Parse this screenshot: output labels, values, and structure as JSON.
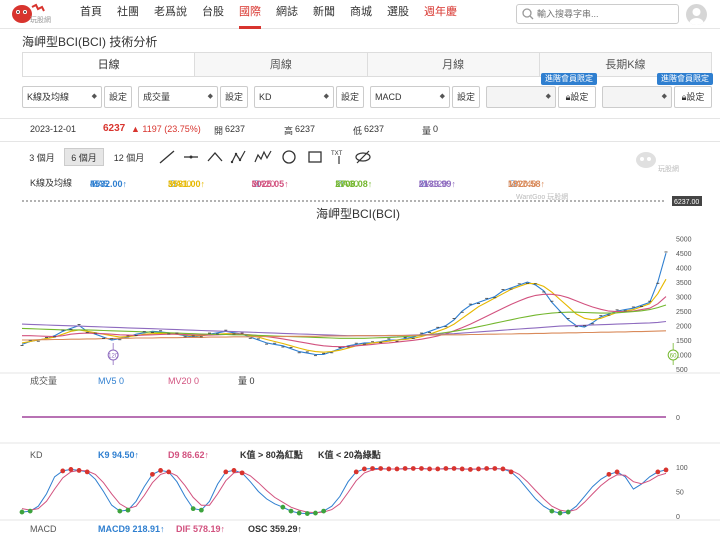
{
  "header": {
    "logo_text": "玩股網",
    "nav": [
      "首頁",
      "社團",
      "老爲說",
      "台股",
      "國際",
      "網誌",
      "新聞",
      "商城",
      "選股",
      "週年慶"
    ],
    "active_nav": "國際",
    "hot_nav": "週年慶",
    "search_placeholder": "輸入搜尋字串..."
  },
  "page_title": "海岬型BCI(BCI) 技術分析",
  "tabs": [
    "日線",
    "周線",
    "月線",
    "長期K線"
  ],
  "active_tab": "日線",
  "selectors": {
    "s1": "K線及均線",
    "s2": "成交量",
    "s3": "KD",
    "s4": "MACD",
    "setting": "設定",
    "badge": "進階會員限定"
  },
  "quote": {
    "date": "2023-12-01",
    "price": "6237",
    "change": "▲ 1197 (23.75%)",
    "open_label": "開",
    "open": "6237",
    "high_label": "高",
    "high": "6237",
    "low_label": "低",
    "low": "6237",
    "vol_label": "量",
    "vol": "0"
  },
  "ranges": [
    "3 個月",
    "6 個月",
    "12 個月"
  ],
  "active_range": "6 個月",
  "ma_row": {
    "label": "K線及均線",
    "items": [
      {
        "name": "MA5",
        "value": "4532.00",
        "color": "#2f7fd0"
      },
      {
        "name": "MA10",
        "value": "3581.00",
        "color": "#e6b800"
      },
      {
        "name": "MA20",
        "value": "3025.05",
        "color": "#d2527f"
      },
      {
        "name": "MA60",
        "value": "2708.08",
        "color": "#74b72e"
      },
      {
        "name": "MA120",
        "value": "2139.99",
        "color": "#8e6bbf"
      },
      {
        "name": "MA240",
        "value": "1820.58",
        "color": "#d98a5a"
      }
    ]
  },
  "watermark": "玩股網",
  "chart_data": [
    {
      "type": "line",
      "title": "海岬型BCI(BCI)",
      "source_label": "WantGoo 玩股網",
      "last_price_label": "6237.00",
      "ylim": [
        500,
        6300
      ],
      "yticks": [
        "5000",
        "4500",
        "4000",
        "3500",
        "3000",
        "2500",
        "2000",
        "1500",
        "1000",
        "500"
      ],
      "markers": [
        {
          "label": "120",
          "color": "#8e6bbf",
          "x": 14
        },
        {
          "label": "60",
          "color": "#74b72e",
          "x": 100
        },
        {
          "label": "20",
          "color": "#d2527f",
          "x": 150
        },
        {
          "label": "10",
          "color": "#e6b800",
          "x": 166
        },
        {
          "label": "5",
          "color": "#2f7fd0",
          "x": 172
        }
      ],
      "series": [
        {
          "name": "MA5",
          "color": "#2f7fd0",
          "values": [
            1350,
            1450,
            1500,
            1550,
            1650,
            1800,
            1900,
            2000,
            1800,
            1700,
            1600,
            1500,
            1550,
            1600,
            1700,
            1750,
            1800,
            1780,
            1750,
            1700,
            1650,
            1600,
            1650,
            1700,
            1750,
            1800,
            1750,
            1700,
            1600,
            1500,
            1400,
            1350,
            1300,
            1200,
            1100,
            1050,
            1000,
            1000,
            1100,
            1200,
            1300,
            1350,
            1400,
            1400,
            1450,
            1500,
            1500,
            1550,
            1600,
            1700,
            1800,
            1900,
            2000,
            2200,
            2500,
            2700,
            2800,
            2900,
            3000,
            3200,
            3300,
            3400,
            3500,
            3400,
            3200,
            2800,
            2500,
            2200,
            2000,
            1950,
            2100,
            2300,
            2400,
            2500,
            2550,
            2600,
            2700,
            2800,
            3500,
            4500
          ]
        },
        {
          "name": "MA10",
          "color": "#e6b800",
          "values": [
            1400,
            1450,
            1500,
            1550,
            1600,
            1700,
            1800,
            1850,
            1800,
            1750,
            1700,
            1650,
            1600,
            1620,
            1650,
            1700,
            1720,
            1730,
            1720,
            1700,
            1680,
            1650,
            1650,
            1680,
            1700,
            1720,
            1720,
            1700,
            1650,
            1600,
            1520,
            1450,
            1380,
            1300,
            1220,
            1150,
            1100,
            1080,
            1100,
            1150,
            1220,
            1300,
            1350,
            1400,
            1430,
            1460,
            1500,
            1520,
            1560,
            1620,
            1700,
            1800,
            1900,
            2050,
            2250,
            2450,
            2650,
            2800,
            2950,
            3100,
            3250,
            3350,
            3450,
            3450,
            3350,
            3150,
            2900,
            2650,
            2400,
            2250,
            2200,
            2250,
            2350,
            2450,
            2500,
            2550,
            2650,
            2750,
            3100,
            3600
          ]
        },
        {
          "name": "MA20",
          "color": "#d2527f",
          "values": [
            1650,
            1650,
            1640,
            1630,
            1620,
            1650,
            1700,
            1730,
            1740,
            1730,
            1720,
            1700,
            1680,
            1670,
            1660,
            1670,
            1680,
            1690,
            1700,
            1700,
            1690,
            1680,
            1670,
            1670,
            1680,
            1690,
            1700,
            1700,
            1680,
            1650,
            1620,
            1580,
            1540,
            1490,
            1440,
            1390,
            1340,
            1300,
            1280,
            1270,
            1280,
            1300,
            1320,
            1350,
            1380,
            1400,
            1430,
            1460,
            1490,
            1530,
            1580,
            1640,
            1720,
            1820,
            1930,
            2050,
            2180,
            2320,
            2460,
            2600,
            2730,
            2850,
            2960,
            3040,
            3080,
            3080,
            3040,
            2960,
            2850,
            2740,
            2640,
            2560,
            2500,
            2480,
            2480,
            2500,
            2550,
            2600,
            2750,
            3000
          ]
        },
        {
          "name": "MA60",
          "color": "#74b72e",
          "values": [
            1900,
            1890,
            1880,
            1870,
            1860,
            1850,
            1850,
            1850,
            1850,
            1840,
            1830,
            1820,
            1810,
            1800,
            1790,
            1780,
            1770,
            1760,
            1750,
            1740,
            1730,
            1720,
            1710,
            1700,
            1690,
            1690,
            1680,
            1680,
            1670,
            1660,
            1650,
            1640,
            1630,
            1620,
            1610,
            1600,
            1590,
            1580,
            1570,
            1560,
            1560,
            1560,
            1560,
            1570,
            1580,
            1590,
            1600,
            1620,
            1640,
            1660,
            1690,
            1720,
            1760,
            1800,
            1850,
            1900,
            1960,
            2020,
            2080,
            2140,
            2200,
            2260,
            2310,
            2360,
            2400,
            2430,
            2450,
            2460,
            2460,
            2450,
            2440,
            2430,
            2430,
            2440,
            2460,
            2480,
            2510,
            2550,
            2620,
            2710
          ]
        },
        {
          "name": "MA120",
          "color": "#8e6bbf",
          "values": [
            2050,
            2040,
            2030,
            2020,
            2010,
            2000,
            1990,
            1980,
            1970,
            1960,
            1950,
            1940,
            1930,
            1920,
            1910,
            1900,
            1890,
            1880,
            1870,
            1860,
            1850,
            1840,
            1830,
            1820,
            1810,
            1800,
            1790,
            1780,
            1770,
            1760,
            1750,
            1740,
            1730,
            1720,
            1710,
            1700,
            1690,
            1680,
            1670,
            1660,
            1650,
            1650,
            1650,
            1650,
            1650,
            1650,
            1650,
            1660,
            1670,
            1680,
            1690,
            1700,
            1710,
            1720,
            1740,
            1760,
            1780,
            1800,
            1820,
            1840,
            1860,
            1880,
            1900,
            1920,
            1940,
            1960,
            1980,
            1990,
            2000,
            2010,
            2020,
            2030,
            2040,
            2050,
            2060,
            2070,
            2080,
            2090,
            2110,
            2140
          ]
        },
        {
          "name": "MA240",
          "color": "#d98a5a",
          "values": [
            1500,
            1500,
            1510,
            1510,
            1520,
            1520,
            1530,
            1530,
            1540,
            1540,
            1550,
            1550,
            1560,
            1560,
            1570,
            1570,
            1570,
            1580,
            1580,
            1580,
            1590,
            1590,
            1590,
            1600,
            1600,
            1600,
            1610,
            1610,
            1610,
            1620,
            1620,
            1620,
            1620,
            1630,
            1630,
            1630,
            1630,
            1640,
            1640,
            1640,
            1640,
            1650,
            1650,
            1650,
            1650,
            1660,
            1660,
            1660,
            1660,
            1670,
            1670,
            1670,
            1680,
            1680,
            1680,
            1690,
            1690,
            1700,
            1700,
            1710,
            1710,
            1720,
            1720,
            1730,
            1730,
            1740,
            1740,
            1750,
            1750,
            1760,
            1760,
            1770,
            1770,
            1780,
            1780,
            1790,
            1790,
            1800,
            1810,
            1820
          ]
        }
      ]
    },
    {
      "type": "line",
      "title": "成交量",
      "items": [
        {
          "name": "MV5",
          "value": "0",
          "color": "#2f7fd0"
        },
        {
          "name": "MV20",
          "value": "0",
          "color": "#d2527f"
        }
      ],
      "vol_label": "量",
      "vol_value": "0",
      "yticks": [
        "0"
      ],
      "series": [
        {
          "name": "成交量",
          "color": "#a0439c",
          "values": [
            0,
            0
          ]
        }
      ]
    },
    {
      "type": "line",
      "title": "KD",
      "items": [
        {
          "name": "K9",
          "value": "94.50",
          "color": "#2f7fd0"
        },
        {
          "name": "D9",
          "value": "86.62",
          "color": "#d2527f"
        }
      ],
      "notes": [
        "K值 > 80為紅點",
        "K值 < 20為綠點"
      ],
      "ylim": [
        0,
        100
      ],
      "yticks": [
        "100",
        "50",
        "0"
      ],
      "series": [
        {
          "name": "K9",
          "color": "#2f7fd0",
          "values": [
            8,
            10,
            20,
            45,
            80,
            92,
            95,
            93,
            90,
            75,
            50,
            22,
            10,
            12,
            30,
            60,
            85,
            93,
            90,
            70,
            40,
            15,
            12,
            30,
            65,
            90,
            93,
            88,
            70,
            50,
            35,
            25,
            18,
            10,
            6,
            5,
            6,
            10,
            20,
            40,
            70,
            90,
            96,
            97,
            97,
            96,
            96,
            97,
            97,
            97,
            96,
            96,
            97,
            97,
            96,
            95,
            96,
            97,
            97,
            96,
            90,
            75,
            55,
            35,
            20,
            10,
            6,
            8,
            20,
            40,
            60,
            75,
            85,
            90,
            80,
            55,
            65,
            80,
            90,
            94
          ]
        },
        {
          "name": "D9",
          "color": "#d2527f",
          "values": [
            15,
            12,
            15,
            30,
            55,
            78,
            90,
            93,
            92,
            85,
            68,
            45,
            25,
            15,
            20,
            42,
            68,
            85,
            90,
            82,
            62,
            38,
            22,
            22,
            45,
            72,
            88,
            90,
            82,
            68,
            52,
            38,
            28,
            18,
            12,
            8,
            7,
            8,
            13,
            25,
            48,
            72,
            88,
            94,
            96,
            96,
            96,
            96,
            97,
            97,
            96,
            96,
            96,
            97,
            96,
            96,
            96,
            96,
            97,
            96,
            93,
            85,
            70,
            52,
            35,
            20,
            12,
            9,
            13,
            28,
            45,
            62,
            75,
            84,
            83,
            70,
            66,
            72,
            82,
            87
          ]
        }
      ]
    },
    {
      "type": "line",
      "title": "MACD",
      "items": [
        {
          "name": "MACD9",
          "value": "218.91",
          "color": "#2f7fd0"
        },
        {
          "name": "DIF",
          "value": "578.19",
          "color": "#d2527f"
        },
        {
          "name": "OSC",
          "value": "359.29",
          "color": "#333"
        }
      ]
    }
  ]
}
